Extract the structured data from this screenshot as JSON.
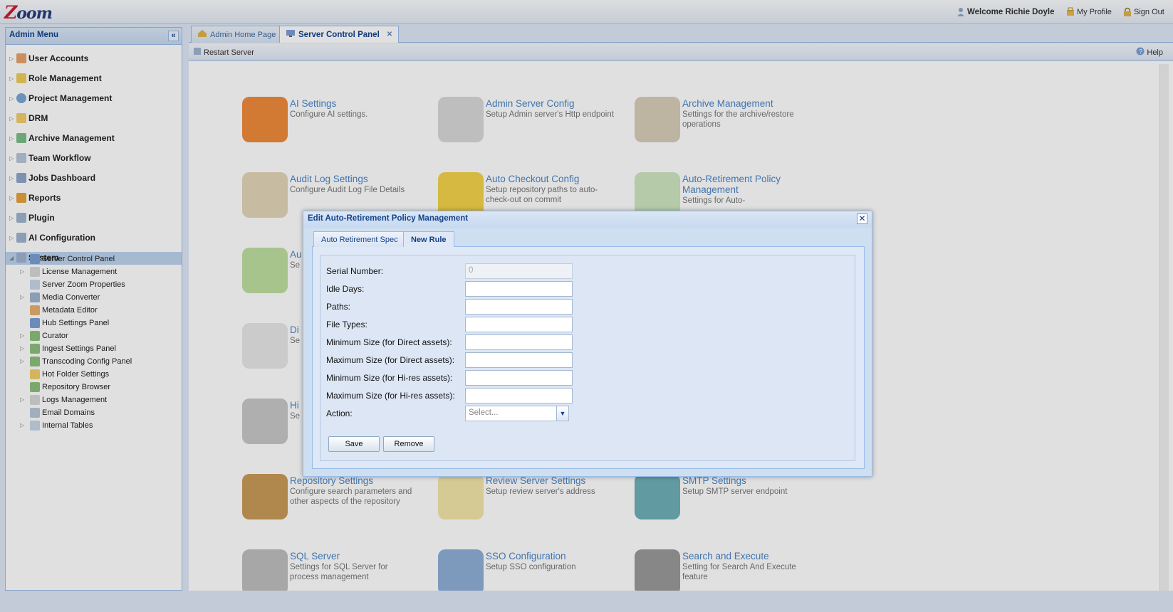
{
  "app": {
    "logo": "Zoom"
  },
  "topbar": {
    "welcome": "Welcome Richie Doyle",
    "my_profile": "My Profile",
    "sign_out": "Sign Out"
  },
  "sidebar": {
    "title": "Admin Menu",
    "items": [
      {
        "label": "User Accounts",
        "icon": "user-icon"
      },
      {
        "label": "Role Management",
        "icon": "shield-icon"
      },
      {
        "label": "Project Management",
        "icon": "pie-chart-icon"
      },
      {
        "label": "DRM",
        "icon": "folder-icon"
      },
      {
        "label": "Archive Management",
        "icon": "archive-icon"
      },
      {
        "label": "Team Workflow",
        "icon": "workflow-icon"
      },
      {
        "label": "Jobs Dashboard",
        "icon": "dashboard-icon"
      },
      {
        "label": "Reports",
        "icon": "report-icon"
      },
      {
        "label": "Plugin",
        "icon": "plugin-icon"
      },
      {
        "label": "AI Configuration",
        "icon": "ai-config-icon"
      },
      {
        "label": "System",
        "icon": "system-icon"
      }
    ],
    "system_children": [
      {
        "label": "Server Control Panel"
      },
      {
        "label": "License Management"
      },
      {
        "label": "Server Zoom Properties"
      },
      {
        "label": "Media Converter"
      },
      {
        "label": "Metadata Editor"
      },
      {
        "label": "Hub Settings Panel"
      },
      {
        "label": "Curator"
      },
      {
        "label": "Ingest Settings Panel"
      },
      {
        "label": "Transcoding Config Panel"
      },
      {
        "label": "Hot Folder Settings"
      },
      {
        "label": "Repository Browser"
      },
      {
        "label": "Logs Management"
      },
      {
        "label": "Email Domains"
      },
      {
        "label": "Internal Tables"
      }
    ]
  },
  "tabs": [
    {
      "label": "Admin Home Page"
    },
    {
      "label": "Server Control Panel"
    }
  ],
  "toolbar": {
    "restart": "Restart Server",
    "help": "Help"
  },
  "tiles": [
    {
      "title": "AI Settings",
      "desc": "Configure AI settings.",
      "color": "#f08a3c"
    },
    {
      "title": "Admin Server Config",
      "desc": "Setup Admin server's Http endpoint",
      "color": "#d9d9d9"
    },
    {
      "title": "Archive Management",
      "desc": "Settings for the archive/restore operations",
      "color": "#d8cdb8"
    },
    {
      "title": "Audit Log Settings",
      "desc": "Configure Audit Log File Details",
      "color": "#e3d6b8"
    },
    {
      "title": "Auto Checkout Config",
      "desc": "Setup repository paths to auto-check-out on commit",
      "color": "#f3d34a"
    },
    {
      "title": "Auto-Retirement Policy Management",
      "desc": "Settings for Auto-",
      "color": "#cfe6c0"
    },
    {
      "title": "Au",
      "desc": "Se",
      "color": "#bfe0a0"
    },
    {
      "title": "Di",
      "desc": "Se",
      "color": "#e8e8e8"
    },
    {
      "title": "Hi",
      "desc": "Se",
      "color": "#c8c8c8"
    },
    {
      "title": "Repository Settings",
      "desc": "Configure search parameters and other aspects of the repository",
      "color": "#c99a57"
    },
    {
      "title": "Review Server Settings",
      "desc": "Setup review server's address",
      "color": "#f3e6a8"
    },
    {
      "title": "SMTP Settings",
      "desc": "Setup SMTP server endpoint",
      "color": "#6fb0b8"
    },
    {
      "title": "SQL Server",
      "desc": "Settings for SQL Server for process management",
      "color": "#bfbfbf"
    },
    {
      "title": "SSO Configuration",
      "desc": "Setup SSO configuration",
      "color": "#8fb0d8"
    },
    {
      "title": "Search and Execute",
      "desc": "Setting for Search And Execute feature",
      "color": "#9a9a9a"
    }
  ],
  "dialog": {
    "title": "Edit Auto-Retirement Policy Management",
    "tabs": [
      {
        "label": "Auto Retirement Spec"
      },
      {
        "label": "New Rule"
      }
    ],
    "fields": [
      {
        "label": "Serial Number:",
        "value": "0"
      },
      {
        "label": "Idle Days:",
        "value": ""
      },
      {
        "label": "Paths:",
        "value": ""
      },
      {
        "label": "File Types:",
        "value": ""
      },
      {
        "label": "Minimum Size (for Direct assets):",
        "value": ""
      },
      {
        "label": "Maximum Size (for Direct assets):",
        "value": ""
      },
      {
        "label": "Minimum Size (for Hi-res assets):",
        "value": ""
      },
      {
        "label": "Maximum Size (for Hi-res assets):",
        "value": ""
      },
      {
        "label": "Action:",
        "value": "Select..."
      }
    ],
    "save_label": "Save",
    "remove_label": "Remove"
  }
}
